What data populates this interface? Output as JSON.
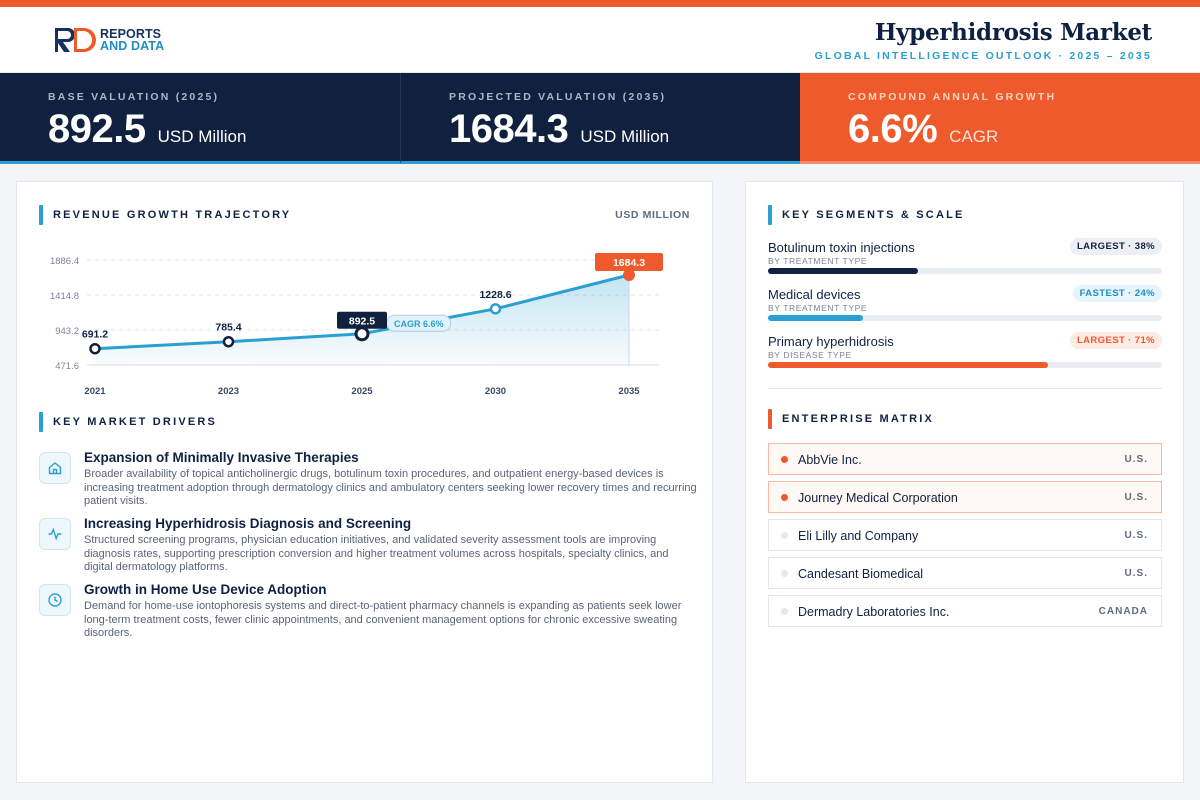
{
  "brand": {
    "line1": "REPORTS",
    "line2": "AND DATA"
  },
  "header": {
    "title": "Hyperhidrosis Market",
    "subtitle": "GLOBAL INTELLIGENCE OUTLOOK  ·  2025 – 2035"
  },
  "kpis": [
    {
      "label": "BASE VALUATION (2025)",
      "value": "892.5",
      "unit": "USD Million"
    },
    {
      "label": "PROJECTED VALUATION (2035)",
      "value": "1684.3",
      "unit": "USD Million"
    },
    {
      "label": "COMPOUND ANNUAL GROWTH",
      "value": "6.6%",
      "unit": "CAGR"
    }
  ],
  "chart_section": {
    "title": "REVENUE GROWTH TRAJECTORY",
    "unit": "USD MILLION"
  },
  "chart_data": {
    "type": "area",
    "title": "REVENUE GROWTH TRAJECTORY",
    "ylabel": "USD MILLION",
    "categories": [
      "2021",
      "2023",
      "2025",
      "2030",
      "2035"
    ],
    "values": [
      691.2,
      785.4,
      892.5,
      1228.6,
      1684.3
    ],
    "data_labels": [
      "691.2",
      "785.4",
      "892.5",
      "1228.6",
      "1684.3"
    ],
    "yticks": [
      1886.4,
      1414.8,
      943.2,
      471.6
    ],
    "ytick_labels": [
      "1886.4",
      "1414.8",
      "943.2",
      "471.6"
    ],
    "ylim": [
      471.6,
      1886.4
    ],
    "grid": true,
    "annotation": "CAGR 6.6%",
    "highlight": {
      "base": "2025",
      "final": "2035"
    },
    "colors": {
      "line": "#2a9fd1",
      "final": "#ef5a2c",
      "dark": "#10213f"
    }
  },
  "drivers_section": {
    "title": "KEY MARKET DRIVERS"
  },
  "drivers": [
    {
      "icon": "home-icon",
      "title": "Expansion of Minimally Invasive Therapies",
      "desc": "Broader availability of topical anticholinergic drugs, botulinum toxin procedures, and outpatient energy-based devices is increasing treatment adoption through dermatology clinics and ambulatory centers seeking lower recovery times and recurring patient visits."
    },
    {
      "icon": "activity-icon",
      "title": "Increasing Hyperhidrosis Diagnosis and Screening",
      "desc": "Structured screening programs, physician education initiatives, and validated severity assessment tools are improving diagnosis rates, supporting prescription conversion and higher treatment volumes across hospitals, specialty clinics, and digital dermatology platforms."
    },
    {
      "icon": "clock-icon",
      "title": "Growth in Home Use Device Adoption",
      "desc": "Demand for home-use iontophoresis systems and direct-to-patient pharmacy channels is expanding as patients seek lower long-term treatment costs, fewer clinic appointments, and convenient management options for chronic excessive sweating disorders."
    }
  ],
  "segments_section": {
    "title": "KEY SEGMENTS & SCALE"
  },
  "segments": [
    {
      "name": "Botulinum toxin injections",
      "category": "BY TREATMENT TYPE",
      "badge": "LARGEST · 38%",
      "share": 0.38,
      "color": "#10213f",
      "badge_bg": "#eceff4",
      "badge_fg": "#0f2142"
    },
    {
      "name": "Medical devices",
      "category": "BY TREATMENT TYPE",
      "badge": "FASTEST · 24%",
      "share": 0.24,
      "color": "#2a9fd1",
      "badge_bg": "#e6f4fb",
      "badge_fg": "#1f8fc4"
    },
    {
      "name": "Primary hyperhidrosis",
      "category": "BY DISEASE TYPE",
      "badge": "LARGEST · 71%",
      "share": 0.71,
      "color": "#ef5a2c",
      "badge_bg": "#fdebe4",
      "badge_fg": "#ef5a2c"
    }
  ],
  "matrix_section": {
    "title": "ENTERPRISE MATRIX"
  },
  "companies": [
    {
      "name": "AbbVie Inc.",
      "country": "U.S.",
      "highlight": true
    },
    {
      "name": "Journey Medical Corporation",
      "country": "U.S.",
      "highlight": true
    },
    {
      "name": "Eli Lilly and Company",
      "country": "U.S.",
      "highlight": false
    },
    {
      "name": "Candesant Biomedical",
      "country": "U.S.",
      "highlight": false
    },
    {
      "name": "Dermadry Laboratories Inc.",
      "country": "CANADA",
      "highlight": false
    }
  ]
}
